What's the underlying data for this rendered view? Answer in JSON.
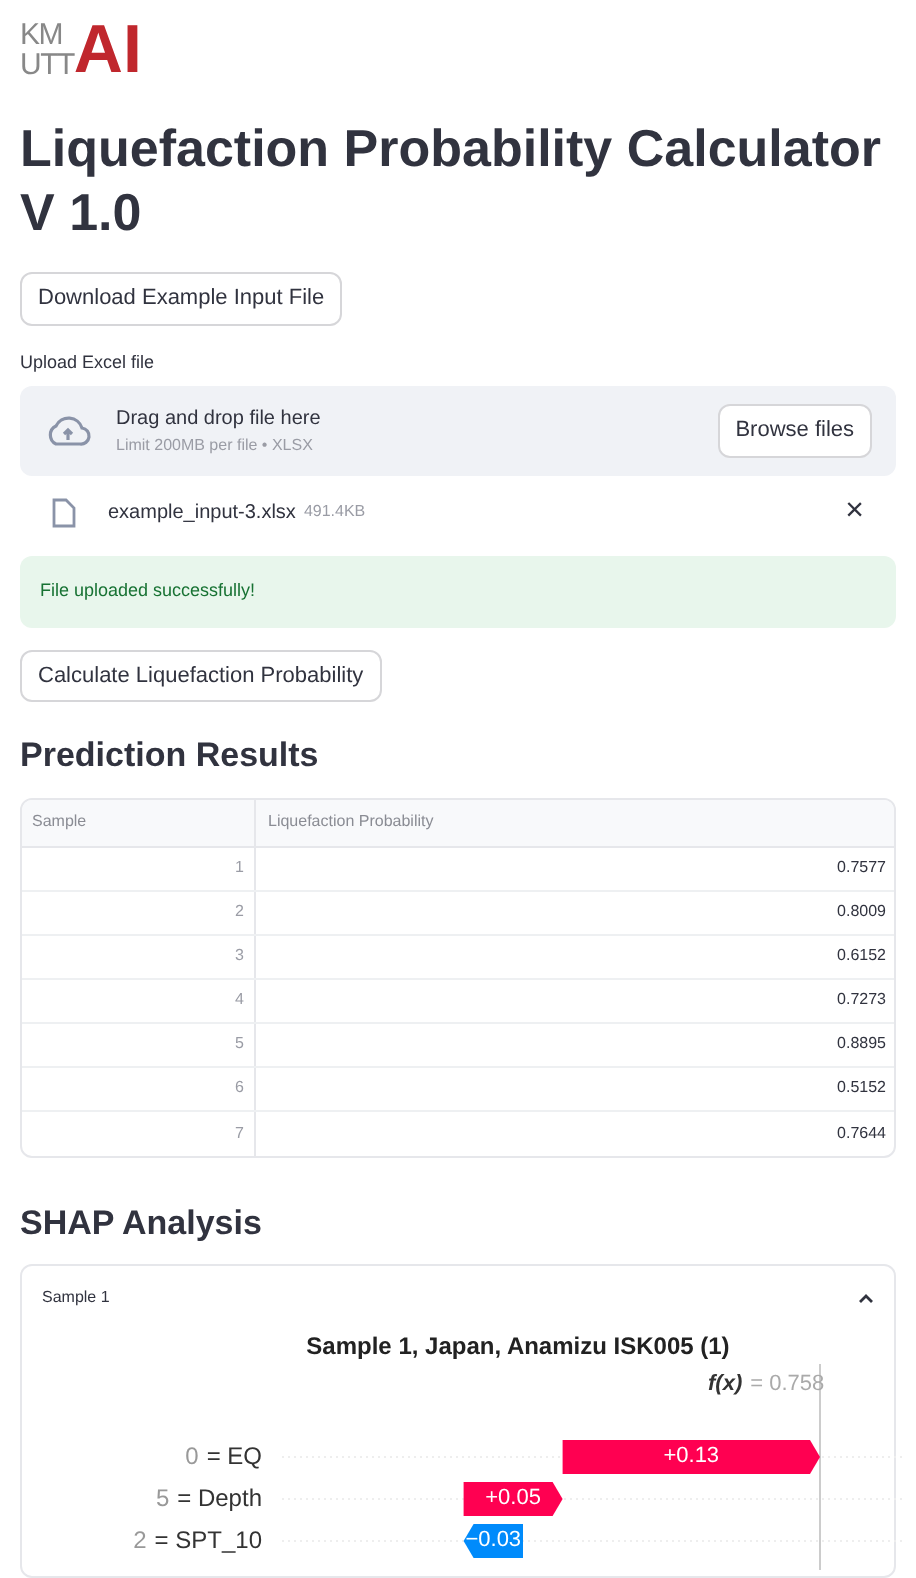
{
  "logo": {
    "line_1": "KM",
    "line_2": "UTT",
    "mark": "AI"
  },
  "title": "Liquefaction Probability Calculator V 1.0",
  "download_button": "Download Example Input File",
  "uploader": {
    "label": "Upload Excel file",
    "prompt": "Drag and drop file here",
    "limit": "Limit 200MB per file • XLSX",
    "browse_button": "Browse files"
  },
  "uploaded_file": {
    "name": "example_input-3.xlsx",
    "size": "491.4KB",
    "remove": "×"
  },
  "success_message": "File uploaded successfully!",
  "calculate_button": "Calculate Liquefaction Probability",
  "results": {
    "heading": "Prediction Results",
    "columns": [
      "Sample",
      "Liquefaction Probability"
    ],
    "rows": [
      [
        "1",
        "0.7577"
      ],
      [
        "2",
        "0.8009"
      ],
      [
        "3",
        "0.6152"
      ],
      [
        "4",
        "0.7273"
      ],
      [
        "5",
        "0.8895"
      ],
      [
        "6",
        "0.5152"
      ],
      [
        "7",
        "0.7644"
      ]
    ]
  },
  "shap": {
    "heading": "SHAP Analysis",
    "expander": {
      "label": "Sample 1",
      "expanded": true
    },
    "plot_title": "Sample 1, Japan, Anamizu ISK005 (1)",
    "fx_label": "f(x)",
    "fx_value": "= 0.758",
    "features": [
      {
        "value_label": "0",
        "name": "= EQ",
        "contribution": "+0.13",
        "kind": "positive"
      },
      {
        "value_label": "5",
        "name": "= Depth",
        "contribution": "+0.05",
        "kind": "positive"
      },
      {
        "value_label": "2",
        "name": "= SPT_10",
        "contribution": "−0.03",
        "kind": "negative"
      }
    ]
  }
}
